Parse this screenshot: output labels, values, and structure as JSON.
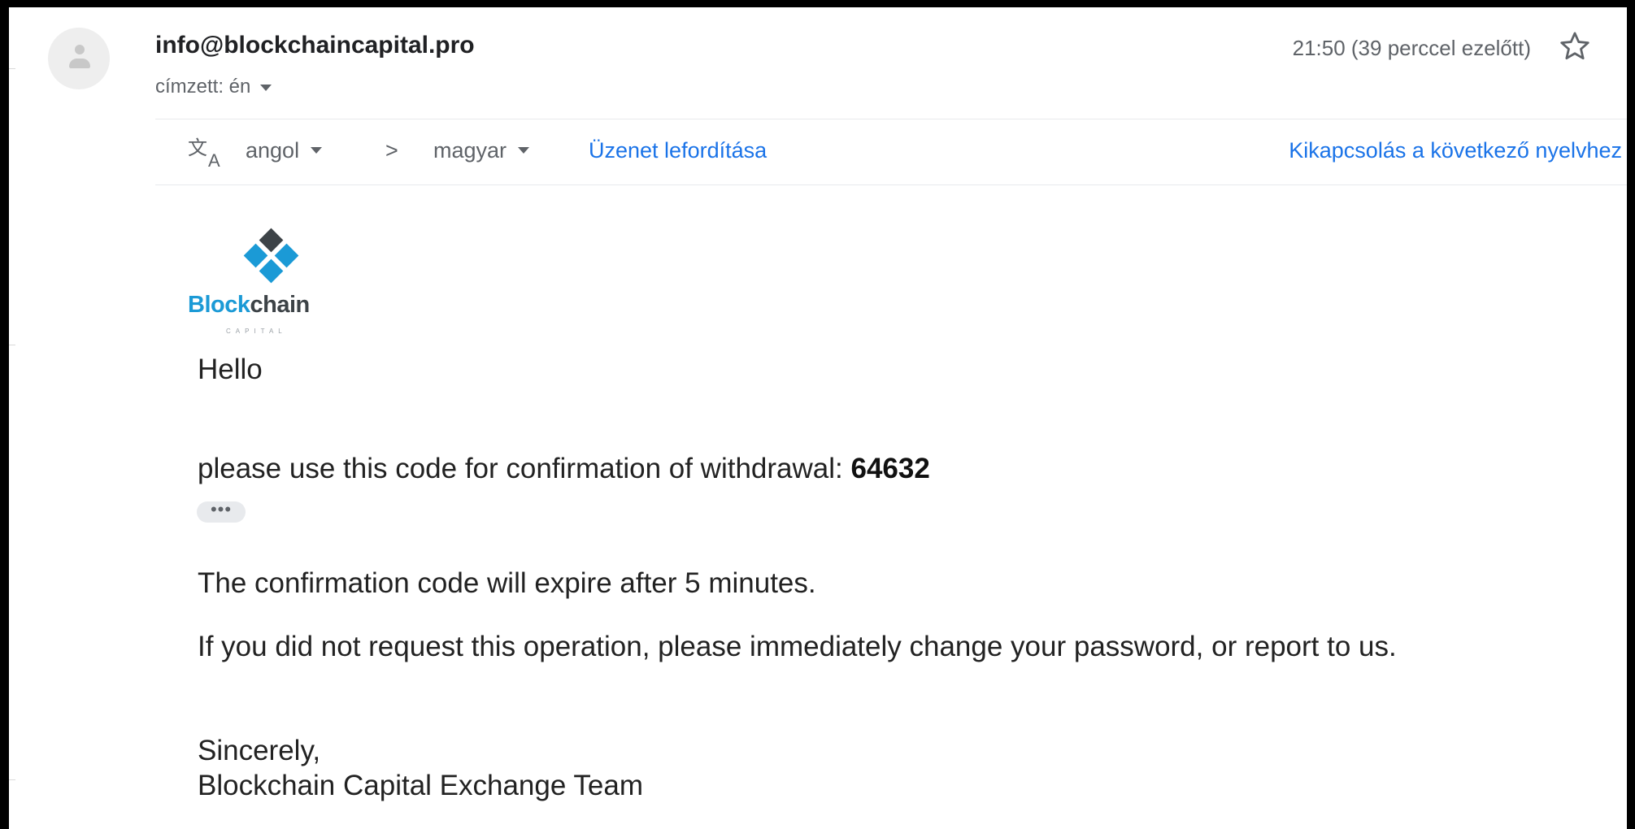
{
  "email": {
    "sender": "info@blockchaincapital.pro",
    "recipient_label": "címzett: én",
    "timestamp": "21:50 (39 perccel ezelőtt)",
    "star_icon": "star-outline-icon"
  },
  "translate_bar": {
    "icon": "translate-icon",
    "source_language": "angol",
    "arrow": ">",
    "target_language": "magyar",
    "translate_link": "Üzenet lefordítása",
    "turn_off_link": "Kikapcsolás a következő nyelvhez"
  },
  "logo": {
    "brand_first": "Block",
    "brand_second": "chain",
    "brand_sub": "CAPITAL",
    "colors": {
      "blue": "#1b9ad6",
      "dark": "#3d4347"
    }
  },
  "body": {
    "greeting": "Hello",
    "code_line_prefix": "please use this code for confirmation of withdrawal:",
    "code": "64632",
    "ellipsis": "•••",
    "expire_line": "The confirmation code will expire after 5 minutes.",
    "warning_line": "If you did not request this operation, please immediately change your password, or report to us.",
    "sign_off": "Sincerely,",
    "signature": "Blockchain Capital Exchange Team"
  }
}
